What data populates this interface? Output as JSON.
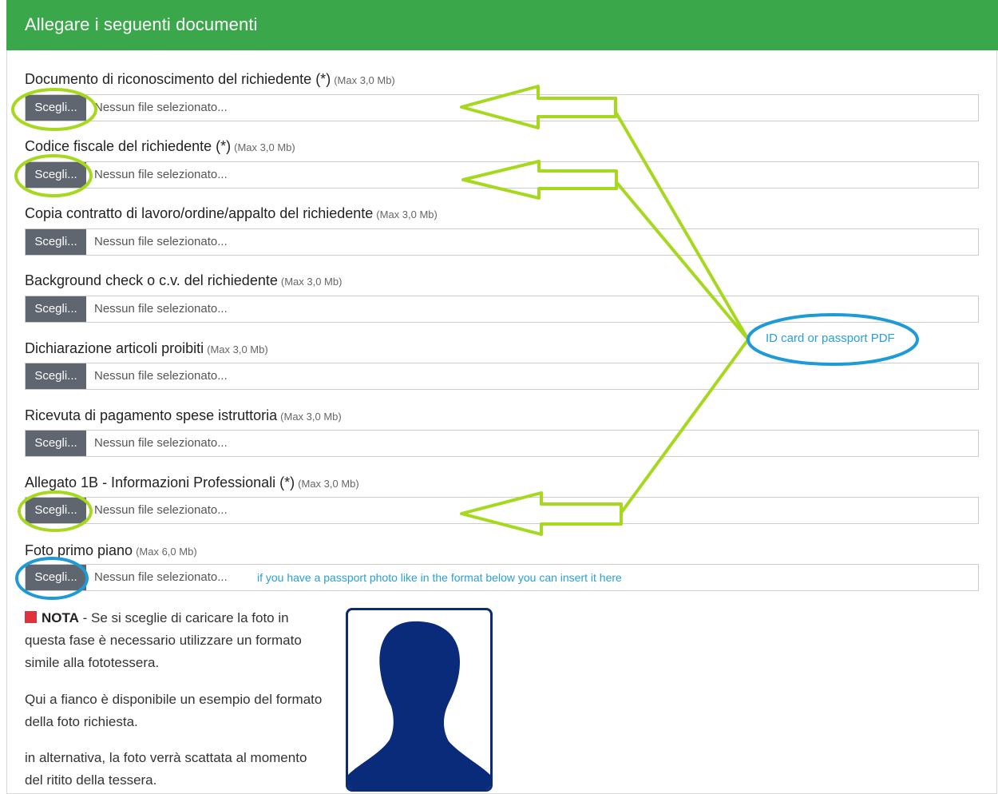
{
  "header": {
    "title": "Allegare i seguenti documenti"
  },
  "fields": [
    {
      "label": "Documento di riconoscimento del richiedente (*)",
      "max": "(Max 3,0 Mb)",
      "button": "Scegli...",
      "placeholder": "Nessun file selezionato..."
    },
    {
      "label": "Codice fiscale del richiedente (*)",
      "max": "(Max 3,0 Mb)",
      "button": "Scegli...",
      "placeholder": "Nessun file selezionato..."
    },
    {
      "label": "Copia contratto di lavoro/ordine/appalto del richiedente",
      "max": "(Max 3,0 Mb)",
      "button": "Scegli...",
      "placeholder": "Nessun file selezionato..."
    },
    {
      "label": "Background check o c.v. del richiedente",
      "max": "(Max 3,0 Mb)",
      "button": "Scegli...",
      "placeholder": "Nessun file selezionato..."
    },
    {
      "label": "Dichiarazione articoli proibiti",
      "max": "(Max 3,0 Mb)",
      "button": "Scegli...",
      "placeholder": "Nessun file selezionato..."
    },
    {
      "label": "Ricevuta di pagamento spese istruttoria",
      "max": "(Max 3,0 Mb)",
      "button": "Scegli...",
      "placeholder": "Nessun file selezionato..."
    },
    {
      "label": "Allegato 1B - Informazioni Professionali (*)",
      "max": "(Max 3,0 Mb)",
      "button": "Scegli...",
      "placeholder": "Nessun file selezionato..."
    },
    {
      "label": "Foto primo piano",
      "max": "(Max 6,0 Mb)",
      "button": "Scegli...",
      "placeholder": "Nessun file selezionato...",
      "hint": "if you have a passport photo like in the format below you can insert it here"
    }
  ],
  "note": {
    "title": "NOTA",
    "text1": " - Se si sceglie di caricare la foto in questa fase è necessario utilizzare un formato simile alla fototessera.",
    "text2": "Qui a fianco è disponibile un esempio del formato della foto richiesta.",
    "text3": "in alternativa, la foto verrà scattata al momento del ritito della tessera."
  },
  "annotation": {
    "label": "ID card or passport PDF"
  },
  "colors": {
    "header": "#3aa74a",
    "button": "#5f6670",
    "annotation_green": "#a6d81e",
    "annotation_blue": "#1e9bd7",
    "photo_silhouette": "#0a2a7a"
  },
  "icons": {
    "photo_placeholder": "person-silhouette-icon",
    "note_marker": "red-square-icon"
  }
}
